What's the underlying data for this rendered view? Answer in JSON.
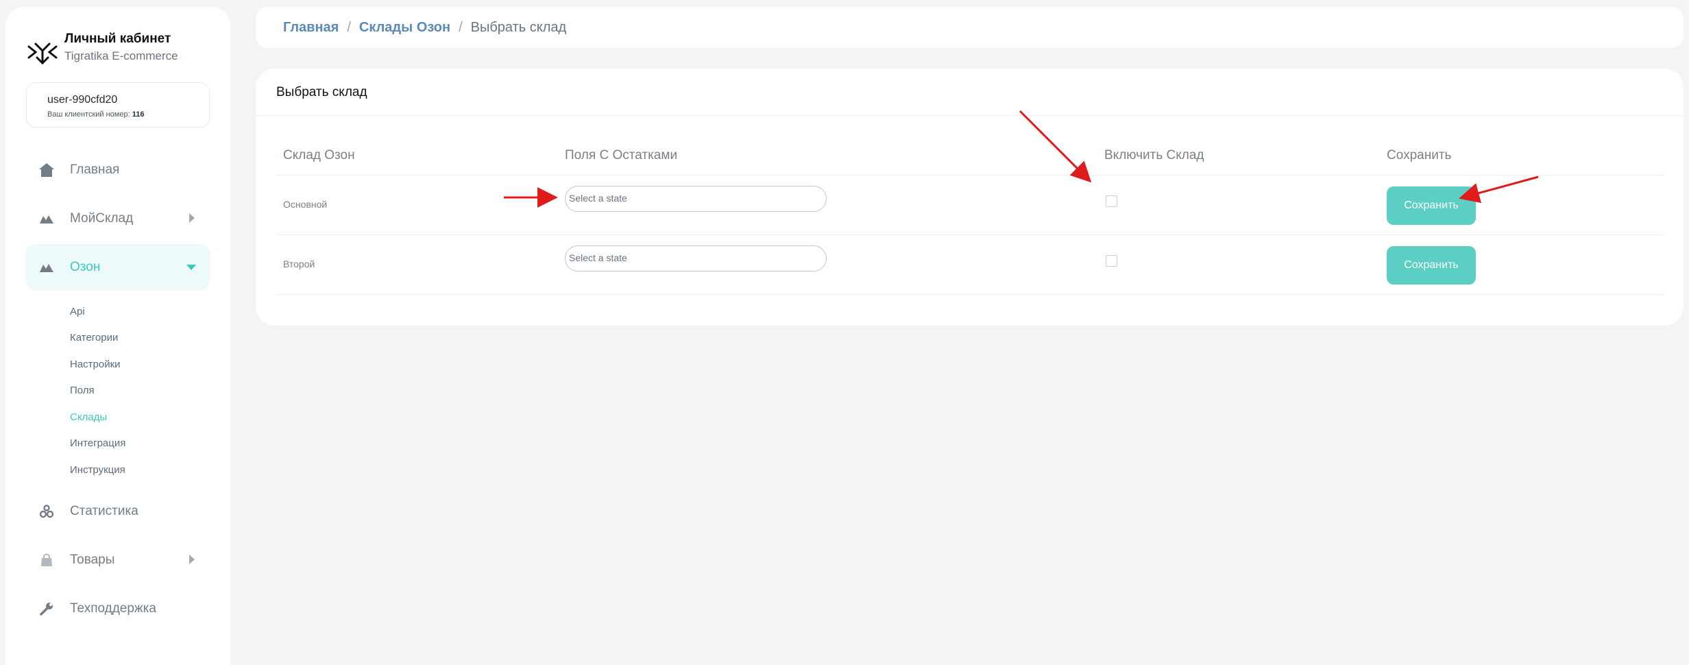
{
  "brand": {
    "title": "Личный кабинет",
    "subtitle": "Tigratika E-commerce"
  },
  "user": {
    "name": "user-990cfd20",
    "client_label": "Ваш клиентский номер:",
    "client_number": "116"
  },
  "nav": {
    "home": "Главная",
    "moysklad": "МойСклад",
    "ozon": "Озон",
    "statistics": "Статистика",
    "goods": "Товары",
    "support": "Техподдержка"
  },
  "ozon_sub": [
    "Api",
    "Категории",
    "Настройки",
    "Поля",
    "Склады",
    "Интеграция",
    "Инструкция"
  ],
  "breadcrumb": {
    "home": "Главная",
    "warehouses": "Склады Озон",
    "current": "Выбрать склад"
  },
  "card": {
    "title": "Выбрать склад",
    "columns": [
      "Склад Озон",
      "Поля С Остатками",
      "Включить Склад",
      "Сохранить"
    ]
  },
  "rows": [
    {
      "name": "Основной",
      "select_placeholder": "Select a state",
      "save_label": "Сохранить"
    },
    {
      "name": "Второй",
      "select_placeholder": "Select a state",
      "save_label": "Сохранить"
    }
  ],
  "colors": {
    "accent": "#38c9c0",
    "button": "#5ccfc4",
    "link": "#5a8ab5",
    "annotation_arrow": "#e01b1b"
  }
}
